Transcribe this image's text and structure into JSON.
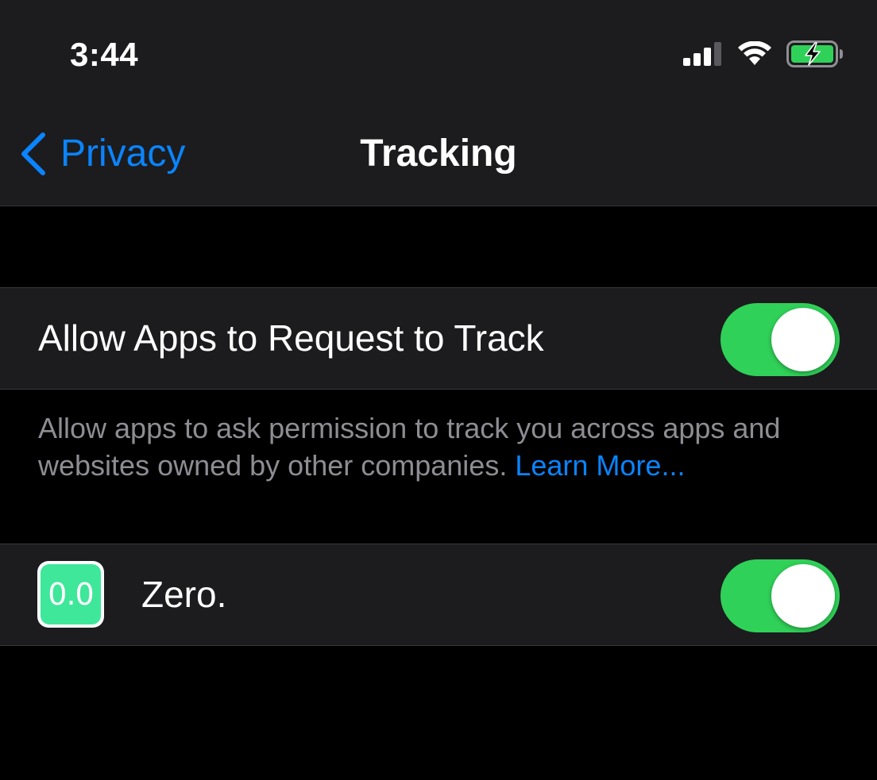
{
  "status_bar": {
    "time": "3:44",
    "icons": [
      "cellular-signal-icon",
      "wifi-icon",
      "battery-charging-icon"
    ]
  },
  "nav": {
    "back_label": "Privacy",
    "title": "Tracking"
  },
  "tracking_setting": {
    "label": "Allow Apps to Request to Track",
    "enabled": true
  },
  "footer": {
    "text": "Allow apps to ask permission to track you across apps and websites owned by other companies.",
    "link": "Learn More..."
  },
  "apps": [
    {
      "name": "Zero.",
      "icon_text": "0.0",
      "enabled": true
    }
  ],
  "colors": {
    "background": "#000000",
    "cell": "#1c1c1e",
    "accent_blue": "#0a84ff",
    "toggle_on": "#30d158",
    "secondary_text": "#8d8d93",
    "app_icon": "#3ee79a"
  }
}
